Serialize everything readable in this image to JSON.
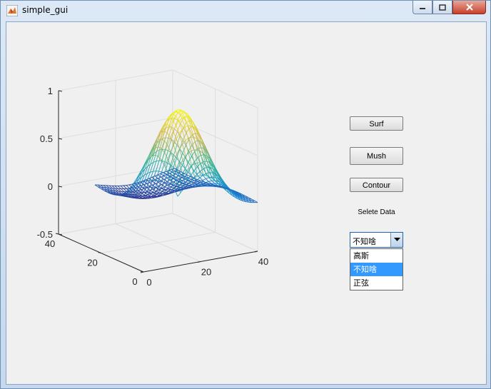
{
  "window": {
    "title": "simple_gui"
  },
  "buttons": {
    "surf": "Surf",
    "mush": "Mush",
    "contour": "Contour"
  },
  "select_label": "Selete Data",
  "dropdown": {
    "selected": "不知啥",
    "options": [
      "高斯",
      "不知啥",
      "正弦"
    ],
    "highlighted_index": 1
  },
  "plot": {
    "type": "mesh",
    "z_ticks": [
      "1",
      "0.5",
      "0",
      "-0.5"
    ],
    "x_ticks": [
      "0",
      "20",
      "40"
    ],
    "y_ticks": [
      "0",
      "20",
      "40"
    ],
    "x_range": [
      0,
      40
    ],
    "y_range": [
      0,
      40
    ],
    "z_range": [
      -0.5,
      1
    ],
    "grid": true,
    "colormap": "parula"
  }
}
